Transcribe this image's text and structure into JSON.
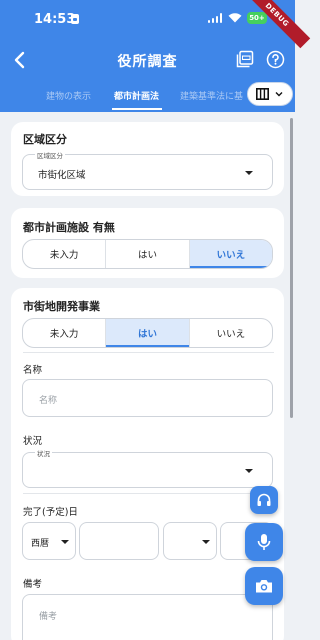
{
  "status_bar": {
    "time": "14:53",
    "battery": "50+"
  },
  "debug_banner": "DEBUG",
  "header": {
    "title": "役所調査"
  },
  "tabs": [
    {
      "label": "建物の表示",
      "active": false
    },
    {
      "label": "都市計画法",
      "active": true
    },
    {
      "label": "建築基準法に基",
      "active": false
    }
  ],
  "zoning": {
    "heading": "区域区分",
    "field_label": "区域区分",
    "value": "市街化区域"
  },
  "city_facility": {
    "heading": "都市計画施設 有無",
    "options": [
      "未入力",
      "はい",
      "いいえ"
    ],
    "selected": "いいえ"
  },
  "development": {
    "heading": "市街地開発事業",
    "options": [
      "未入力",
      "はい",
      "いいえ"
    ],
    "selected": "はい",
    "name_label": "名称",
    "name_placeholder": "名称",
    "status_label": "状況",
    "status_field_label": "状況",
    "completion_label": "完了(予定)日",
    "era": "西暦",
    "notes_label": "備考",
    "notes_placeholder": "備考"
  },
  "icons": {
    "back": "arrow-back-icon",
    "pdf": "pdf-icon",
    "help": "help-icon",
    "columns": "view-column-icon",
    "headset": "headset-icon",
    "mic": "mic-icon",
    "camera": "camera-icon"
  },
  "colors": {
    "primary": "#3f86e8",
    "selected_bg": "#dce9fb",
    "background": "#eef1f5"
  }
}
